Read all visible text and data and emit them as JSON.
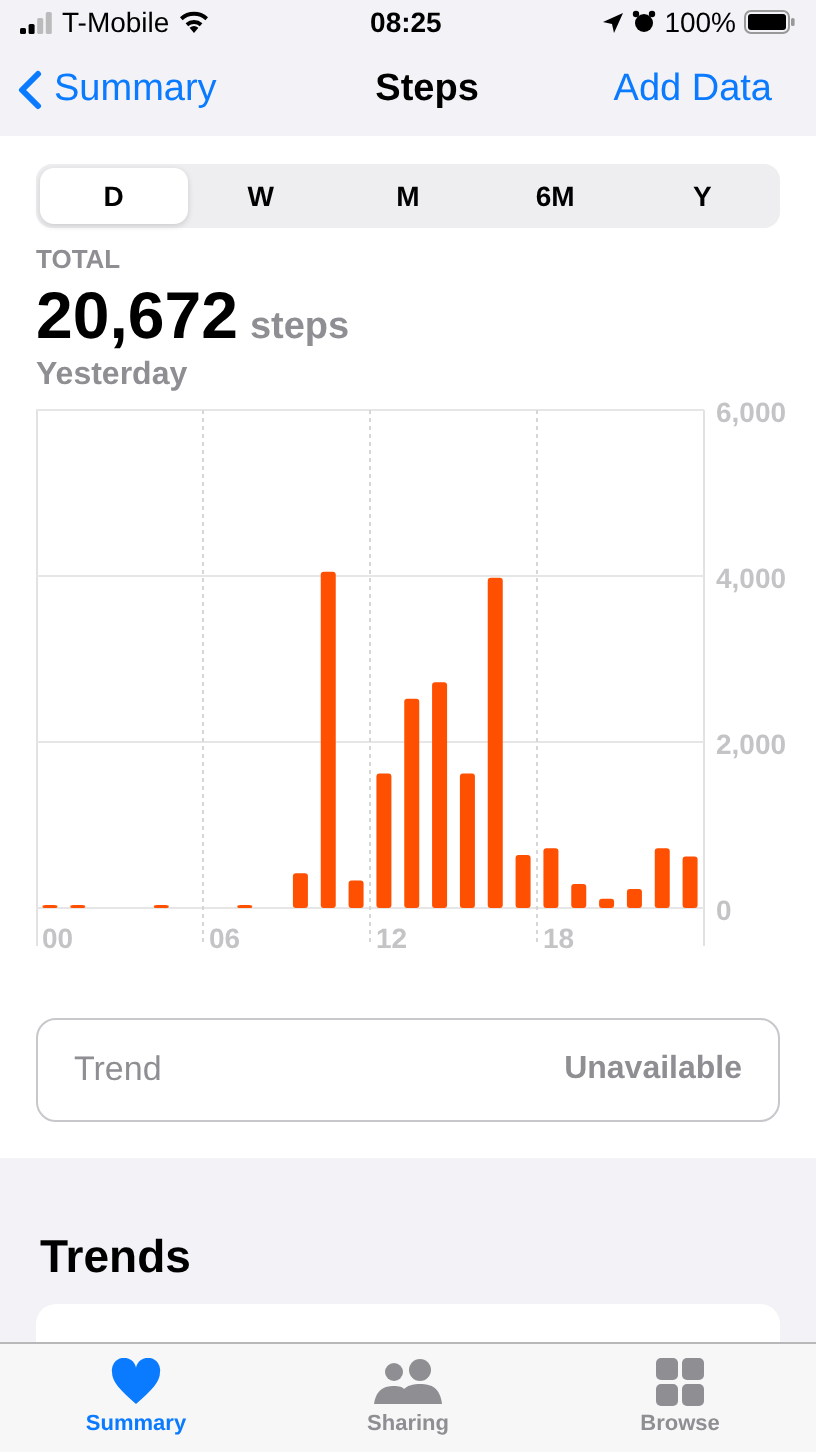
{
  "status_bar": {
    "carrier": "T-Mobile",
    "time": "08:25",
    "battery": "100%"
  },
  "nav": {
    "back": "Summary",
    "title": "Steps",
    "action": "Add Data"
  },
  "segments": [
    {
      "label": "D",
      "selected": true
    },
    {
      "label": "W",
      "selected": false
    },
    {
      "label": "M",
      "selected": false
    },
    {
      "label": "6M",
      "selected": false
    },
    {
      "label": "Y",
      "selected": false
    }
  ],
  "summary": {
    "label": "TOTAL",
    "value": "20,672",
    "unit": "steps",
    "period": "Yesterday"
  },
  "chart_data": {
    "type": "bar",
    "x": [
      0,
      1,
      4,
      7,
      9,
      10,
      11,
      12,
      13,
      14,
      15,
      16,
      17,
      18,
      19,
      20,
      21,
      22,
      23
    ],
    "xlim": [
      -0.5,
      23.5
    ],
    "series": [
      {
        "color": "#ff4f00",
        "values": [
          10,
          10,
          10,
          10,
          420,
          4050,
          330,
          1620,
          2520,
          2720,
          1620,
          3980,
          640,
          720,
          290,
          110,
          230,
          720,
          620
        ]
      }
    ],
    "ylim": [
      0,
      6000
    ],
    "yticks": [
      {
        "value": 0,
        "label": "0"
      },
      {
        "value": 2000,
        "label": "2,000"
      },
      {
        "value": 4000,
        "label": "4,000"
      },
      {
        "value": 6000,
        "label": "6,000"
      }
    ],
    "xticks": [
      {
        "value": 0,
        "label": "00"
      },
      {
        "value": 6,
        "label": "06"
      },
      {
        "value": 12,
        "label": "12"
      },
      {
        "value": 18,
        "label": "18"
      }
    ]
  },
  "trend": {
    "label": "Trend",
    "value": "Unavailable"
  },
  "trends_title": "Trends",
  "tab_bar": [
    {
      "label": "Summary",
      "kind": "heart",
      "selected": true
    },
    {
      "label": "Sharing",
      "kind": "people",
      "selected": false
    },
    {
      "label": "Browse",
      "kind": "grid",
      "selected": false
    }
  ]
}
